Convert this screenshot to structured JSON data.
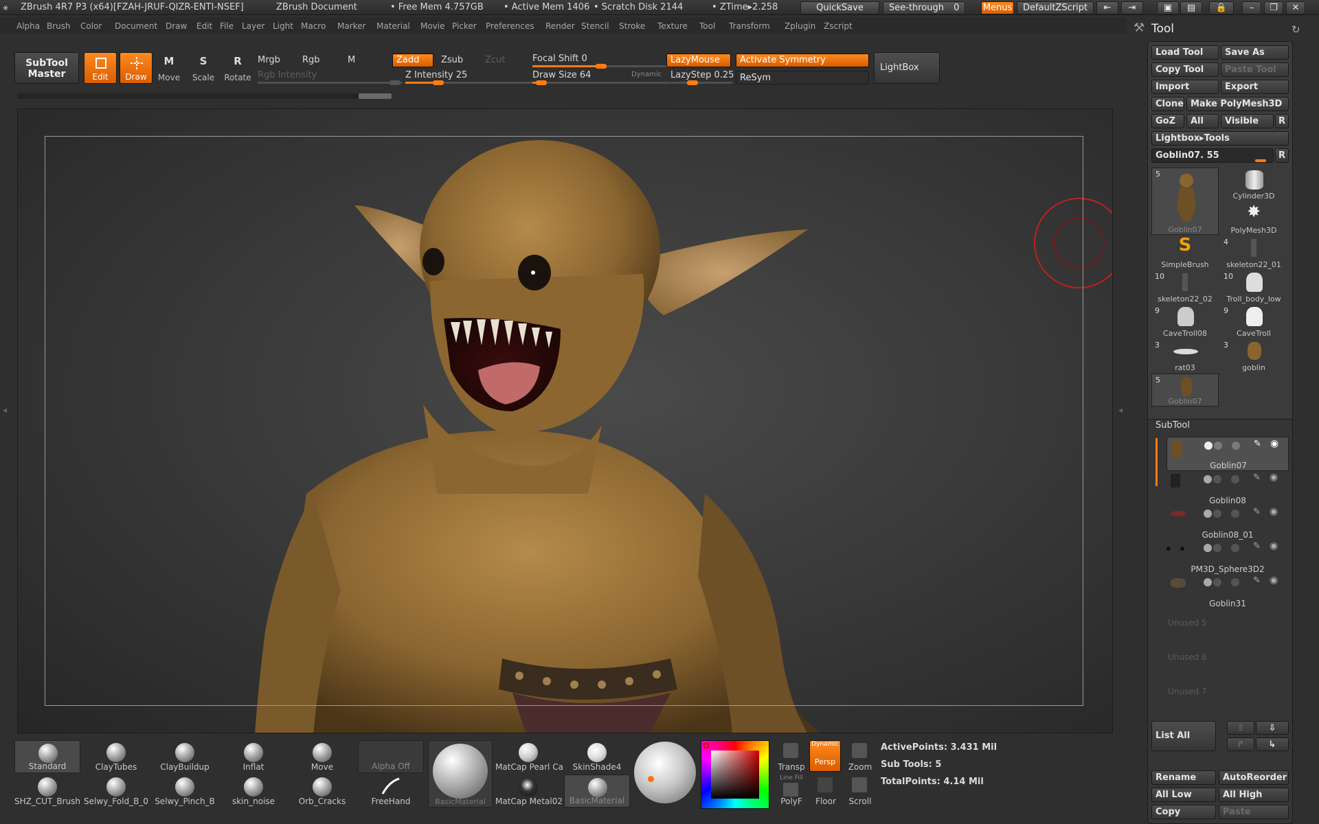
{
  "titlebar": {
    "app": "ZBrush 4R7 P3 (x64)[FZAH-JRUF-QIZR-ENTI-NSEF]",
    "document": "ZBrush Document",
    "free_mem": "• Free Mem 4.757GB",
    "active_mem": "• Active Mem 1406",
    "scratch": "• Scratch Disk 2144",
    "ztime": "• ZTime▸2.258",
    "quicksave": "QuickSave",
    "seethrough": "See-through",
    "seethrough_val": "0",
    "menus": "Menus",
    "script": "DefaultZScript"
  },
  "menubar": [
    "Alpha",
    "Brush",
    "Color",
    "Document",
    "Draw",
    "Edit",
    "File",
    "Layer",
    "Light",
    "Macro",
    "Marker",
    "Material",
    "Movie",
    "Picker",
    "Preferences",
    "Render",
    "Stencil",
    "Stroke",
    "Texture",
    "Tool",
    "Transform",
    "Zplugin",
    "Zscript"
  ],
  "toolbar": {
    "subtool_master_1": "SubTool",
    "subtool_master_2": "Master",
    "edit": "Edit",
    "draw": "Draw",
    "move": "Move",
    "scale": "Scale",
    "rotate": "Rotate",
    "mrgb": "Mrgb",
    "rgb": "Rgb",
    "m": "M",
    "zadd": "Zadd",
    "zsub": "Zsub",
    "zcut": "Zcut",
    "rgb_intensity": "Rgb Intensity",
    "z_intensity": "Z Intensity 25",
    "focal_shift": "Focal Shift 0",
    "draw_size": "Draw Size 64",
    "dynamic": "Dynamic",
    "lazymouse": "LazyMouse",
    "lazystep": "LazyStep 0.25",
    "activate_symmetry": "Activate Symmetry",
    "resym": "ReSym",
    "lightbox": "LightBox",
    "z_intensity_value": 25,
    "focal_shift_value": 0,
    "draw_size_value": 64
  },
  "bottom": {
    "brushes_row1": [
      "Standard",
      "ClayTubes",
      "ClayBuildup",
      "Inflat",
      "Move"
    ],
    "brushes_row2": [
      "SHZ_CUT_Brush",
      "Selwy_Fold_B_0",
      "Selwy_Pinch_B",
      "skin_noise",
      "Orb_Cracks"
    ],
    "alpha_off": "Alpha Off",
    "freehand": "FreeHand",
    "basic_material": "BasicMaterial",
    "matcap1": "MatCap Pearl Ca",
    "skinshade": "SkinShade4",
    "matcap2": "MatCap Metal02",
    "basic_material2": "BasicMaterial",
    "transp": "Transp",
    "dynamic": "Dynamic",
    "persp": "Persp",
    "zoom": "Zoom",
    "linefill": "Line Fill",
    "polyf": "PolyF",
    "floor": "Floor",
    "scroll": "Scroll",
    "active_points": "ActivePoints: 3.431 Mil",
    "sub_tools": "Sub Tools: 5",
    "total_points": "TotalPoints: 4.14 Mil"
  },
  "tool_panel": {
    "title": "Tool",
    "load_tool": "Load Tool",
    "save_as": "Save As",
    "copy_tool": "Copy Tool",
    "paste_tool": "Paste Tool",
    "import": "Import",
    "export": "Export",
    "clone": "Clone",
    "make_polymesh": "Make PolyMesh3D",
    "goz": "GoZ",
    "all": "All",
    "visible": "Visible",
    "r": "R",
    "lightbox_tools": "Lightbox▸Tools",
    "current_tool": "Goblin07. 55",
    "thumbs": [
      {
        "name": "Goblin07",
        "num": "5"
      },
      {
        "name": "Cylinder3D",
        "num": ""
      },
      {
        "name": "PolyMesh3D",
        "num": ""
      },
      {
        "name": "SimpleBrush",
        "num": ""
      },
      {
        "name": "skeleton22_01",
        "num": "4"
      },
      {
        "name": "skeleton22_02",
        "num": "10"
      },
      {
        "name": "Troll_body_low",
        "num": "10"
      },
      {
        "name": "CaveTroll08",
        "num": "9"
      },
      {
        "name": "CaveTroll",
        "num": "9"
      },
      {
        "name": "rat03",
        "num": "3"
      },
      {
        "name": "goblin",
        "num": "3"
      },
      {
        "name": "Goblin07",
        "num": "5"
      }
    ]
  },
  "subtool_panel": {
    "title": "SubTool",
    "items": [
      "Goblin07",
      "Goblin08",
      "Goblin08_01",
      "PM3D_Sphere3D2",
      "Goblin31"
    ],
    "unused": [
      "Unused 5",
      "Unused 6",
      "Unused 7"
    ],
    "list_all": "List All",
    "rename": "Rename",
    "autoreorder": "AutoReorder",
    "all_low": "All Low",
    "all_high": "All High",
    "copy": "Copy",
    "paste": "Paste"
  }
}
